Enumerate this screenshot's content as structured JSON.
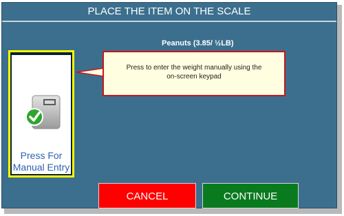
{
  "header": {
    "title": "PLACE THE ITEM ON THE SCALE"
  },
  "item": {
    "name": "Peanuts (3.85/ ½LB)"
  },
  "manual_entry": {
    "label_line1": "Press For",
    "label_line2": "Manual Entry",
    "icon": "scale-with-check-icon"
  },
  "tooltip": {
    "line1": "Press to enter the weight manually using the",
    "line2": "on-screen keypad"
  },
  "buttons": {
    "cancel_label": "CANCEL",
    "continue_label": "CONTINUE"
  },
  "colors": {
    "background": "#3c6f8e",
    "highlight": "#ffff00",
    "cancel": "#ff0000",
    "continue": "#0a7a1f",
    "tooltip_border": "#c8141c"
  }
}
